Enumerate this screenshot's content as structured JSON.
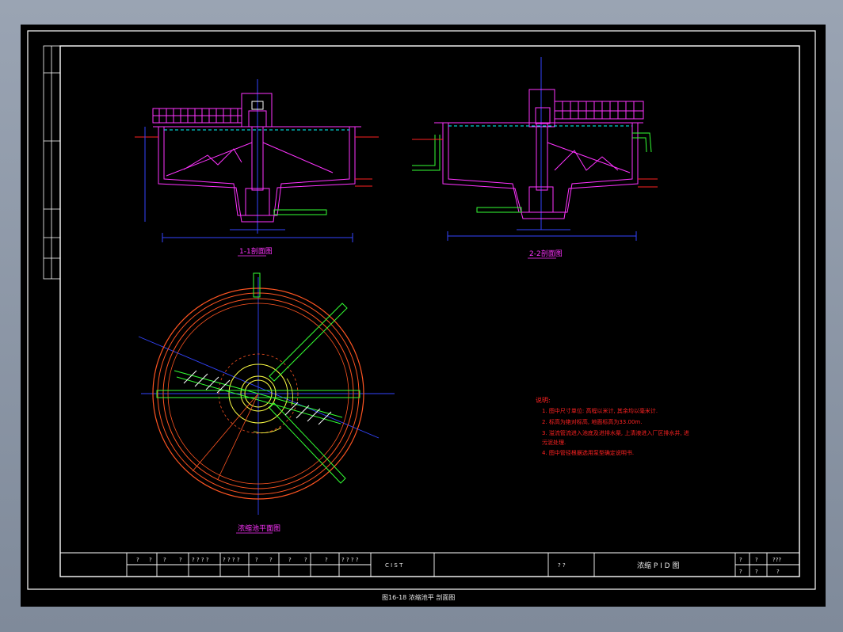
{
  "drawing": {
    "section1_caption": "1-1剖面图",
    "section2_caption": "2-2剖面图",
    "plan_caption": "浓缩池平面图",
    "footer_caption": "图16-18 浓缩池平 剖面图",
    "notes": {
      "heading": "说明:",
      "items": [
        "1. 图中尺寸单位: 高程以米计, 其余均以毫米计.",
        "2. 标高为绝对标高, 地面标高为33.00m.",
        "3. 溢流管流进入池底及进排水渠, 上清液进入厂区排水井, 进",
        "   污泥处理.",
        "4. 图中管径根据选用泵型确定说明书."
      ]
    },
    "title_block": {
      "cells": [
        "?",
        "?",
        "?",
        "?",
        "? ? ? ?",
        "? ? ? ?",
        "?",
        "?",
        "?",
        "?",
        "?",
        "? ? ? ?"
      ],
      "code": "C  I  S  T",
      "review": "?    ?",
      "title": "浓缩 P I D 图",
      "r1": "?",
      "r2": "?",
      "r3": "???",
      "r4": "?",
      "r5": "?",
      "r6": "?"
    }
  },
  "colors": {
    "structure": "#ff33ff",
    "pipe": "#33ff33",
    "dimension": "#3344ff",
    "frame": "#ffffff",
    "notes": "#ff2222",
    "plan_ring": "#ff5522",
    "water": "#00ffff"
  }
}
